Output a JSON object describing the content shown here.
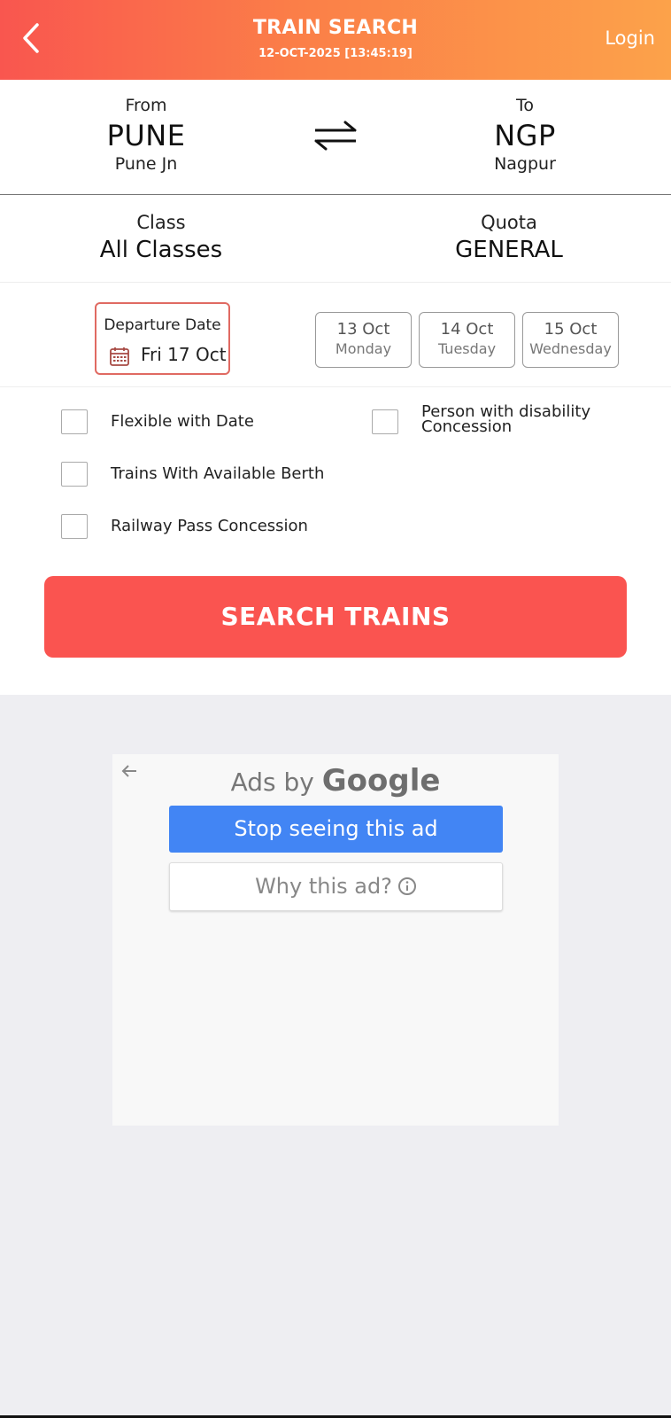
{
  "header": {
    "title": "TRAIN SEARCH",
    "subtitle": "12-OCT-2025 [13:45:19]",
    "login_label": "Login",
    "back_icon": "chevron-left-icon"
  },
  "stations": {
    "from": {
      "label": "From",
      "code": "PUNE",
      "name": "Pune Jn"
    },
    "to": {
      "label": "To",
      "code": "NGP",
      "name": "Nagpur"
    },
    "swap_icon": "swap-arrows-icon"
  },
  "class": {
    "label": "Class",
    "value": "All Classes"
  },
  "quota": {
    "label": "Quota",
    "value": "GENERAL"
  },
  "departure": {
    "label": "Departure Date",
    "value": "Fri 17 Oct",
    "icon": "calendar-icon"
  },
  "date_chips": [
    {
      "date": "13 Oct",
      "day": "Monday"
    },
    {
      "date": "14 Oct",
      "day": "Tuesday"
    },
    {
      "date": "15 Oct",
      "day": "Wednesday"
    }
  ],
  "options": {
    "flexible": "Flexible with Date",
    "disability": "Person with disability Concession",
    "available_berth": "Trains With Available Berth",
    "railway_pass": "Railway Pass Concession"
  },
  "search_button": "SEARCH TRAINS",
  "ad": {
    "ads_by": "Ads by ",
    "google": "Google",
    "stop_label": "Stop seeing this ad",
    "why_label": "Why this ad?"
  },
  "colors": {
    "header_gradient_start": "#f9564f",
    "header_gradient_end": "#fca24a",
    "search_button": "#fa5450",
    "ad_stop_button": "#4285f4"
  }
}
